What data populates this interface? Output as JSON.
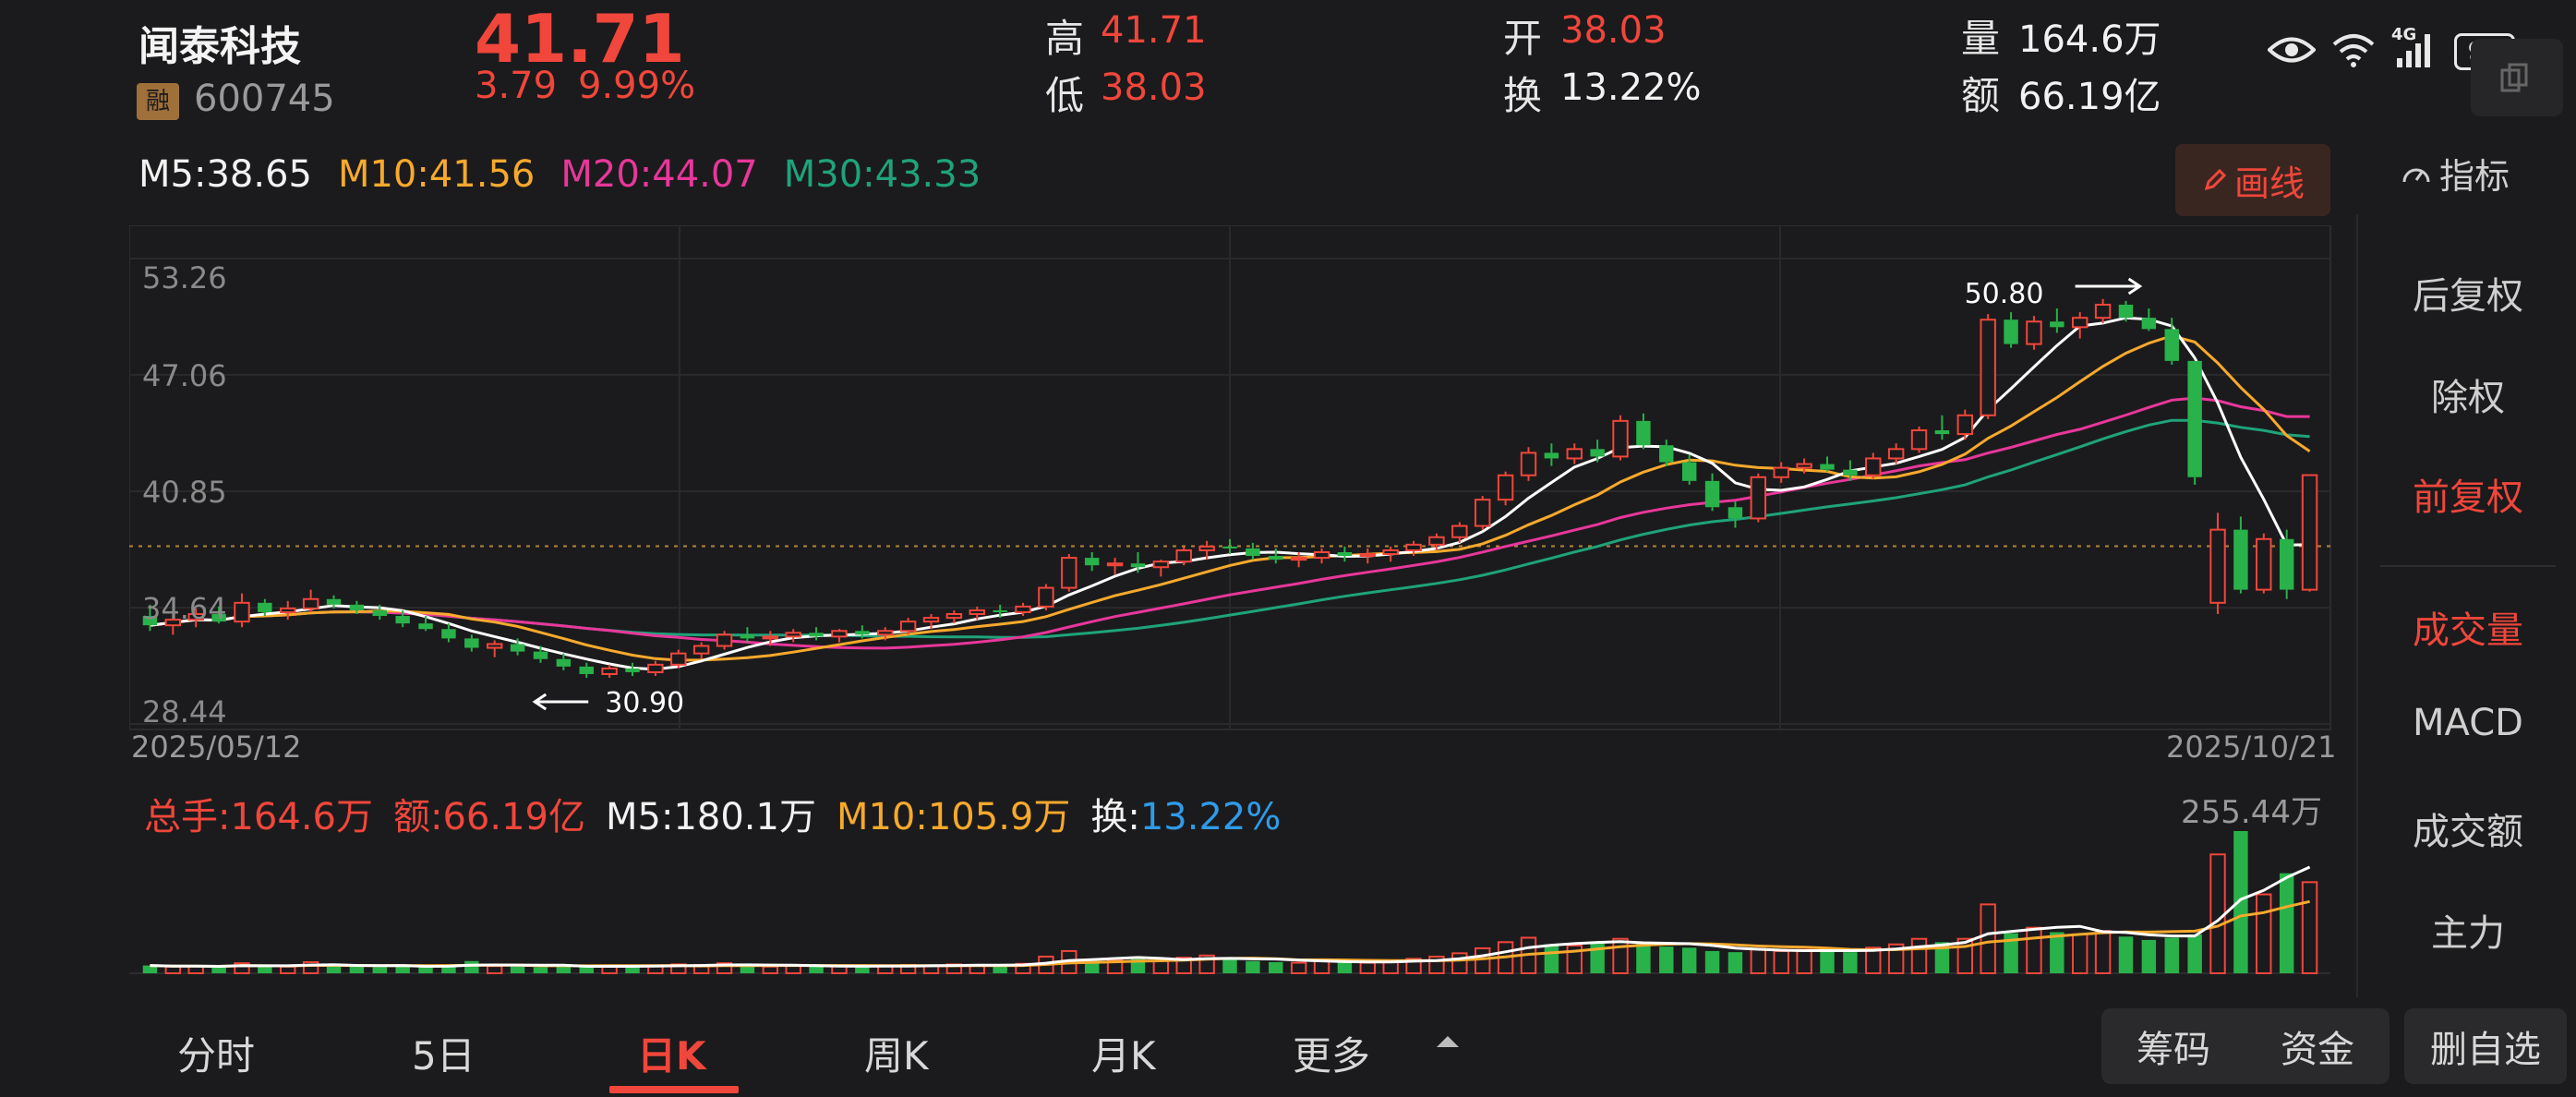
{
  "stock": {
    "name": "闻泰科技",
    "badge": "融",
    "code": "600745",
    "price": "41.71",
    "change": "3.79",
    "change_pct": "9.99%"
  },
  "quote": {
    "high_label": "高",
    "high": "41.71",
    "low_label": "低",
    "low": "38.03",
    "open_label": "开",
    "open": "38.03",
    "turnover_label": "换",
    "turnover": "13.22%",
    "volume_label": "量",
    "volume": "164.6万",
    "amount_label": "额",
    "amount": "66.19亿"
  },
  "status_bar": {
    "battery": "98",
    "network": "4G"
  },
  "ma": {
    "m5": "M5:38.65",
    "m10": "M10:41.56",
    "m20": "M20:44.07",
    "m30": "M30:43.33"
  },
  "toolbar": {
    "draw_label": "画线",
    "indicator_label": "指标"
  },
  "right_panel": {
    "items": [
      "后复权",
      "除权",
      "前复权",
      "成交量",
      "MACD",
      "成交额",
      "主力"
    ],
    "active": [
      "前复权",
      "成交量"
    ]
  },
  "volume_row": {
    "total": "总手:164.6万",
    "amount": "额:66.19亿",
    "m5": "M5:180.1万",
    "m10": "M10:105.9万",
    "turnover_label": "换:",
    "turnover": "13.22%"
  },
  "bottom_nav": {
    "tabs": [
      "分时",
      "5日",
      "日K",
      "周K",
      "月K",
      "更多"
    ],
    "active": "日K",
    "buttons": [
      "筹码",
      "资金",
      "删自选"
    ]
  },
  "colors": {
    "up": "#f1463b",
    "down": "#29b24a",
    "ma5": "#ffffff",
    "ma10": "#f7a92c",
    "ma20": "#e8379a",
    "ma30": "#1fa37a"
  },
  "chart_data": [
    {
      "type": "candlestick",
      "y_ticks": [
        "53.26",
        "47.06",
        "40.85",
        "34.64",
        "28.44"
      ],
      "ylim": [
        28.44,
        53.26
      ],
      "x_start": "2025/05/12",
      "x_end": "2025/10/21",
      "annotations": [
        {
          "text": "50.80",
          "value": 50.8
        },
        {
          "text": "30.90",
          "value": 30.9
        }
      ],
      "reference_price": 37.92,
      "candles": [
        [
          34.2,
          34.8,
          33.4,
          33.7
        ],
        [
          33.7,
          34.3,
          33.2,
          34.0
        ],
        [
          34.0,
          34.6,
          33.6,
          34.3
        ],
        [
          34.3,
          34.7,
          33.8,
          33.9
        ],
        [
          33.9,
          35.4,
          33.6,
          34.9
        ],
        [
          34.9,
          35.1,
          34.2,
          34.4
        ],
        [
          34.4,
          35.0,
          34.0,
          34.6
        ],
        [
          34.6,
          35.6,
          34.4,
          35.1
        ],
        [
          35.1,
          35.3,
          34.6,
          34.8
        ],
        [
          34.8,
          35.0,
          34.3,
          34.5
        ],
        [
          34.5,
          34.8,
          34.0,
          34.2
        ],
        [
          34.2,
          34.5,
          33.6,
          33.8
        ],
        [
          33.8,
          34.2,
          33.4,
          33.5
        ],
        [
          33.5,
          33.8,
          32.8,
          33.0
        ],
        [
          33.0,
          33.2,
          32.3,
          32.5
        ],
        [
          32.5,
          32.9,
          32.0,
          32.7
        ],
        [
          32.7,
          33.0,
          32.1,
          32.3
        ],
        [
          32.3,
          32.6,
          31.7,
          31.9
        ],
        [
          31.9,
          32.2,
          31.3,
          31.5
        ],
        [
          31.5,
          31.7,
          30.9,
          31.1
        ],
        [
          31.1,
          31.6,
          30.9,
          31.4
        ],
        [
          31.4,
          31.7,
          31.0,
          31.2
        ],
        [
          31.2,
          31.8,
          31.0,
          31.6
        ],
        [
          31.6,
          32.4,
          31.4,
          32.2
        ],
        [
          32.2,
          32.8,
          31.9,
          32.6
        ],
        [
          32.6,
          33.4,
          32.4,
          33.2
        ],
        [
          33.2,
          33.6,
          32.8,
          33.0
        ],
        [
          33.0,
          33.4,
          32.6,
          33.1
        ],
        [
          33.1,
          33.5,
          32.8,
          33.3
        ],
        [
          33.3,
          33.6,
          32.9,
          33.1
        ],
        [
          33.1,
          33.5,
          32.8,
          33.4
        ],
        [
          33.4,
          33.7,
          33.0,
          33.2
        ],
        [
          33.2,
          33.6,
          32.9,
          33.4
        ],
        [
          33.4,
          34.1,
          33.2,
          33.9
        ],
        [
          33.9,
          34.3,
          33.5,
          34.1
        ],
        [
          34.1,
          34.5,
          33.8,
          34.3
        ],
        [
          34.3,
          34.7,
          34.0,
          34.5
        ],
        [
          34.5,
          34.8,
          34.1,
          34.4
        ],
        [
          34.4,
          34.9,
          34.2,
          34.7
        ],
        [
          34.7,
          35.9,
          34.5,
          35.7
        ],
        [
          35.7,
          37.5,
          35.5,
          37.3
        ],
        [
          37.3,
          37.6,
          36.6,
          36.9
        ],
        [
          36.9,
          37.3,
          36.4,
          37.0
        ],
        [
          37.0,
          37.6,
          36.5,
          36.8
        ],
        [
          36.8,
          37.2,
          36.3,
          37.1
        ],
        [
          37.1,
          37.9,
          36.9,
          37.7
        ],
        [
          37.7,
          38.2,
          37.2,
          37.9
        ],
        [
          37.9,
          38.3,
          37.5,
          37.8
        ],
        [
          37.8,
          38.1,
          37.2,
          37.4
        ],
        [
          37.4,
          37.8,
          37.0,
          37.2
        ],
        [
          37.2,
          37.6,
          36.8,
          37.3
        ],
        [
          37.3,
          37.8,
          37.0,
          37.6
        ],
        [
          37.6,
          37.9,
          37.1,
          37.4
        ],
        [
          37.4,
          37.8,
          37.0,
          37.5
        ],
        [
          37.5,
          37.9,
          37.1,
          37.7
        ],
        [
          37.7,
          38.2,
          37.4,
          38.0
        ],
        [
          38.0,
          38.6,
          37.7,
          38.4
        ],
        [
          38.4,
          39.2,
          38.1,
          39.0
        ],
        [
          39.0,
          40.6,
          38.8,
          40.4
        ],
        [
          40.4,
          41.9,
          40.1,
          41.7
        ],
        [
          41.7,
          43.2,
          41.4,
          42.9
        ],
        [
          42.9,
          43.4,
          42.2,
          42.6
        ],
        [
          42.6,
          43.4,
          42.3,
          43.1
        ],
        [
          43.1,
          43.6,
          42.4,
          42.7
        ],
        [
          42.7,
          44.9,
          42.5,
          44.6
        ],
        [
          44.6,
          45.0,
          43.1,
          43.3
        ],
        [
          43.3,
          43.6,
          42.2,
          42.4
        ],
        [
          42.4,
          42.8,
          41.2,
          41.4
        ],
        [
          41.4,
          41.8,
          39.8,
          40.0
        ],
        [
          40.0,
          40.3,
          38.9,
          39.4
        ],
        [
          39.4,
          41.8,
          39.2,
          41.6
        ],
        [
          41.6,
          42.4,
          41.3,
          42.1
        ],
        [
          42.1,
          42.6,
          41.8,
          42.3
        ],
        [
          42.3,
          42.7,
          41.9,
          42.0
        ],
        [
          42.0,
          42.5,
          41.4,
          41.7
        ],
        [
          41.7,
          42.9,
          41.5,
          42.6
        ],
        [
          42.6,
          43.4,
          42.3,
          43.1
        ],
        [
          43.1,
          44.3,
          42.9,
          44.1
        ],
        [
          44.1,
          44.9,
          43.6,
          43.9
        ],
        [
          43.9,
          45.2,
          43.6,
          44.9
        ],
        [
          44.9,
          50.3,
          44.7,
          50.0
        ],
        [
          50.0,
          50.4,
          48.5,
          48.7
        ],
        [
          48.7,
          50.2,
          48.4,
          49.9
        ],
        [
          49.9,
          50.6,
          49.3,
          49.6
        ],
        [
          49.6,
          50.4,
          49.0,
          50.1
        ],
        [
          50.1,
          51.1,
          49.8,
          50.8
        ],
        [
          50.8,
          51.0,
          49.9,
          50.1
        ],
        [
          50.1,
          50.6,
          49.4,
          49.5
        ],
        [
          49.5,
          50.1,
          47.6,
          47.8
        ],
        [
          47.8,
          43.9,
          41.2,
          41.6
        ],
        [
          34.9,
          39.7,
          34.3,
          38.8
        ],
        [
          38.8,
          39.5,
          35.4,
          35.6
        ],
        [
          35.6,
          38.6,
          35.4,
          38.3
        ],
        [
          38.3,
          38.8,
          35.1,
          35.6
        ],
        [
          35.6,
          41.71,
          35.5,
          41.71
        ]
      ]
    },
    {
      "type": "bar",
      "title": "成交量",
      "y_max_label": "255.44万",
      "values": [
        14,
        12,
        13,
        11,
        18,
        13,
        12,
        20,
        14,
        12,
        11,
        13,
        12,
        15,
        22,
        13,
        12,
        11,
        14,
        12,
        13,
        12,
        14,
        16,
        15,
        18,
        13,
        12,
        14,
        12,
        13,
        12,
        13,
        15,
        14,
        16,
        15,
        13,
        17,
        30,
        40,
        22,
        24,
        26,
        22,
        28,
        32,
        26,
        22,
        20,
        19,
        24,
        20,
        19,
        20,
        26,
        30,
        36,
        45,
        56,
        64,
        52,
        50,
        56,
        62,
        54,
        48,
        46,
        40,
        38,
        44,
        40,
        42,
        40,
        38,
        46,
        52,
        62,
        56,
        62,
        124,
        72,
        82,
        74,
        70,
        76,
        66,
        60,
        64,
        70,
        214,
        256,
        142,
        180,
        164
      ]
    }
  ]
}
